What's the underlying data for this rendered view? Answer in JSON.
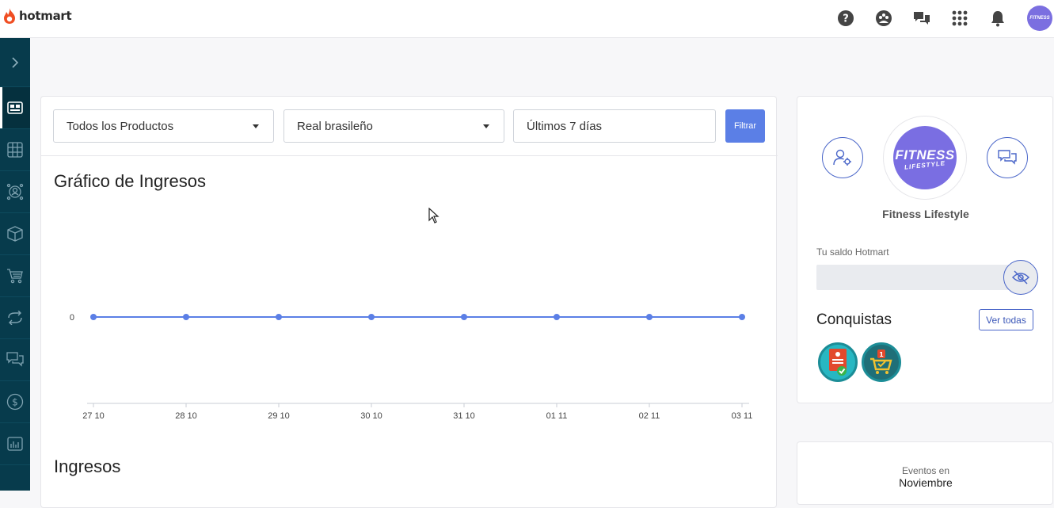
{
  "brand": {
    "name": "hotmart",
    "accent": "#f04e23"
  },
  "header": {
    "icons": [
      "help-icon",
      "community-icon",
      "chat-icon",
      "apps-grid-icon",
      "bell-icon"
    ],
    "avatar_text": "FITNESS"
  },
  "sidebar": {
    "items": [
      "chevron-right-icon",
      "dashboard-icon",
      "apps-icon",
      "affiliate-icon",
      "product-box-icon",
      "cart-icon",
      "recurrence-icon",
      "messages-icon",
      "dollar-icon",
      "reports-icon"
    ]
  },
  "filters": {
    "product": "Todos los Productos",
    "currency": "Real brasileño",
    "period": "Últimos 7 días",
    "filter_button": "Filtrar"
  },
  "chart_title": "Gráfico de Ingresos",
  "chart_data": {
    "type": "line",
    "title": "Gráfico de Ingresos",
    "categories": [
      "27 10",
      "28 10",
      "29 10",
      "30 10",
      "31 10",
      "01 11",
      "02 11",
      "03 11"
    ],
    "series": [
      {
        "values": [
          0,
          0,
          0,
          0,
          0,
          0,
          0,
          0
        ]
      }
    ],
    "y_ticks": [
      "0"
    ],
    "color": "#5b7fe6"
  },
  "section_title": "Ingresos",
  "profile": {
    "avatar_line1": "FITNESS",
    "avatar_line2": "LIFESTYLE",
    "name": "Fitness Lifestyle",
    "balance_label": "Tu saldo Hotmart",
    "achievements_title": "Conquistas",
    "see_all": "Ver todas"
  },
  "events": {
    "label": "Eventos en",
    "month": "Noviembre"
  }
}
